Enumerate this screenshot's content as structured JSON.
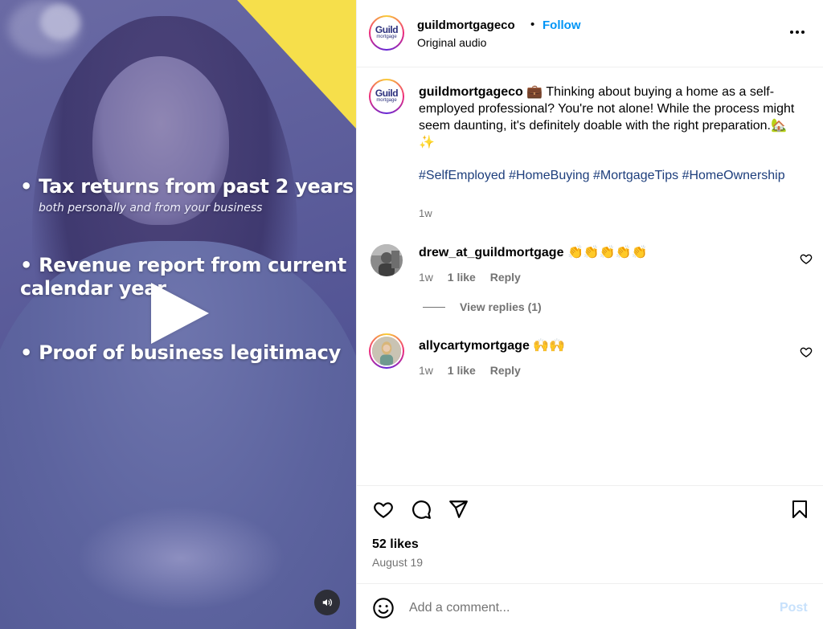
{
  "video": {
    "bullet1": "• Tax returns from past 2 years",
    "bullet1_sub": "both personally and from your business",
    "bullet2": "• Revenue report from current calendar year",
    "bullet3": "• Proof of business legitimacy",
    "accent_color": "#f6df4b",
    "play_icon": "play-icon",
    "mute_icon": "speaker-icon"
  },
  "post": {
    "avatar_text": "Guild",
    "avatar_subtext": "mortgage",
    "username": "guildmortgageco",
    "separator": "•",
    "follow_label": "Follow",
    "audio": "Original audio",
    "caption_text": "💼 Thinking about buying a home as a self-employed professional? You're not alone! While the process might seem daunting, it's definitely doable with the right preparation.🏡✨",
    "hashtags": "#SelfEmployed #HomeBuying #MortgageTips #HomeOwnership",
    "caption_time": "1w",
    "likes": "52 likes",
    "date": "August 19"
  },
  "comments": [
    {
      "username": "drew_at_guildmortgage",
      "emoji": "👏👏👏👏👏",
      "time": "1w",
      "likes": "1 like",
      "reply_label": "Reply"
    },
    {
      "username": "allycartymortgage",
      "emoji": "🙌🙌",
      "time": "1w",
      "likes": "1 like",
      "reply_label": "Reply"
    }
  ],
  "view_replies": "View replies (1)",
  "add_comment": {
    "placeholder": "Add a comment...",
    "post_label": "Post"
  },
  "colors": {
    "follow": "#0095f6",
    "hashtag": "#1d3e7c",
    "muted": "#737373",
    "post_disabled": "#c7e1fc"
  }
}
